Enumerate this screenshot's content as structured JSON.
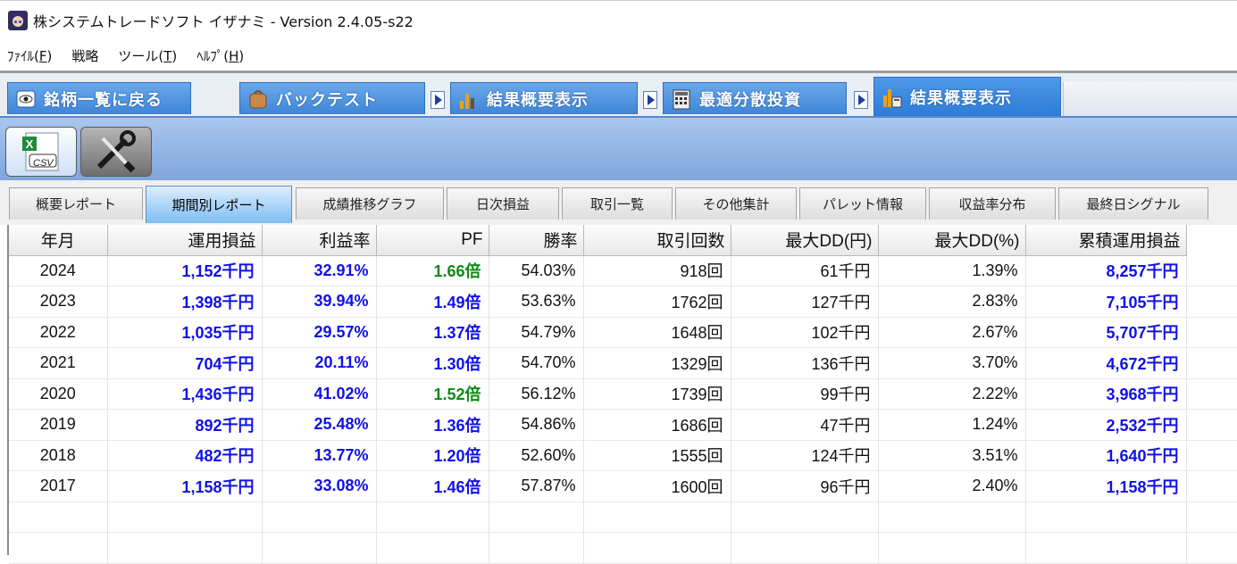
{
  "window": {
    "title": "株システムトレードソフト イザナミ - Version 2.4.05-s22"
  },
  "menu": [
    {
      "label": "ﾌｧｲﾙ(",
      "key": "F",
      "suffix": ")"
    },
    {
      "label": "戦略",
      "key": "",
      "suffix": ""
    },
    {
      "label": "ツール(",
      "key": "T",
      "suffix": ")"
    },
    {
      "label": "ﾍﾙﾌﾟ(",
      "key": "H",
      "suffix": ")"
    }
  ],
  "workflow": {
    "back_label": "銘柄一覧に戻る",
    "backtest_label": "バックテスト",
    "summary_label": "結果概要表示",
    "optimize_label": "最適分散投資",
    "summary2_label": "結果概要表示"
  },
  "toolbar": {
    "csv_text": "CSV"
  },
  "report_tabs": [
    "概要レポート",
    "期間別レポート",
    "成績推移グラフ",
    "日次損益",
    "取引一覧",
    "その他集計",
    "パレット情報",
    "収益率分布",
    "最終日シグナル"
  ],
  "active_tab_index": 1,
  "table": {
    "columns": [
      "年月",
      "運用損益",
      "利益率",
      "PF",
      "勝率",
      "取引回数",
      "最大DD(円)",
      "最大DD(%)",
      "累積運用損益"
    ],
    "rows": [
      [
        "2024",
        "1,152千円",
        "32.91%",
        "1.66倍",
        "54.03%",
        "918回",
        "61千円",
        "1.39%",
        "8,257千円"
      ],
      [
        "2023",
        "1,398千円",
        "39.94%",
        "1.49倍",
        "53.63%",
        "1762回",
        "127千円",
        "2.83%",
        "7,105千円"
      ],
      [
        "2022",
        "1,035千円",
        "29.57%",
        "1.37倍",
        "54.79%",
        "1648回",
        "102千円",
        "2.67%",
        "5,707千円"
      ],
      [
        "2021",
        "704千円",
        "20.11%",
        "1.30倍",
        "54.70%",
        "1329回",
        "136千円",
        "3.70%",
        "4,672千円"
      ],
      [
        "2020",
        "1,436千円",
        "41.02%",
        "1.52倍",
        "56.12%",
        "1739回",
        "99千円",
        "2.22%",
        "3,968千円"
      ],
      [
        "2019",
        "892千円",
        "25.48%",
        "1.36倍",
        "54.86%",
        "1686回",
        "47千円",
        "1.24%",
        "2,532千円"
      ],
      [
        "2018",
        "482千円",
        "13.77%",
        "1.20倍",
        "52.60%",
        "1555回",
        "124千円",
        "3.51%",
        "1,640千円"
      ],
      [
        "2017",
        "1,158千円",
        "33.08%",
        "1.46倍",
        "57.87%",
        "1600回",
        "96千円",
        "2.40%",
        "1,158千円"
      ]
    ],
    "pf_green_rows": [
      0,
      4
    ],
    "colors": {
      "value_blue": "#1010e8",
      "pf_green": "#0d8a15",
      "active_tab": "#7fbdf2",
      "workflow_blue": "#3f86d8"
    }
  }
}
